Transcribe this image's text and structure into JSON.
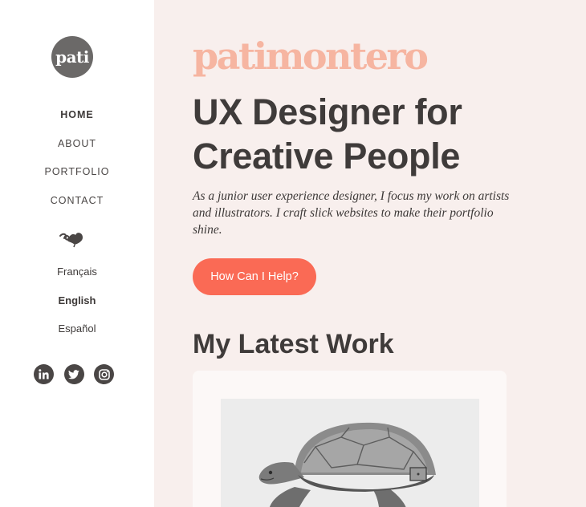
{
  "sidebar": {
    "logo_text": "pati",
    "nav": [
      "HOME",
      "ABOUT",
      "PORTFOLIO",
      "CONTACT"
    ],
    "languages": [
      "Français",
      "English",
      "Español"
    ],
    "social_icons": [
      "linkedin-icon",
      "twitter-icon",
      "instagram-icon"
    ]
  },
  "main": {
    "brand": "patimontero",
    "headline_line1": "UX Designer for",
    "headline_line2": "Creative People",
    "intro": "As a junior user experience designer, I focus my work on artists and illustrators. I craft slick websites to make their portfolio shine.",
    "cta_label": "How Can I Help?",
    "section_title": "My Latest Work"
  },
  "colors": {
    "sidebar_bg": "#ffffff",
    "main_bg": "#f8efed",
    "brand": "#f6b5a1",
    "cta": "#fa6a55",
    "text": "#3f3b3a"
  }
}
